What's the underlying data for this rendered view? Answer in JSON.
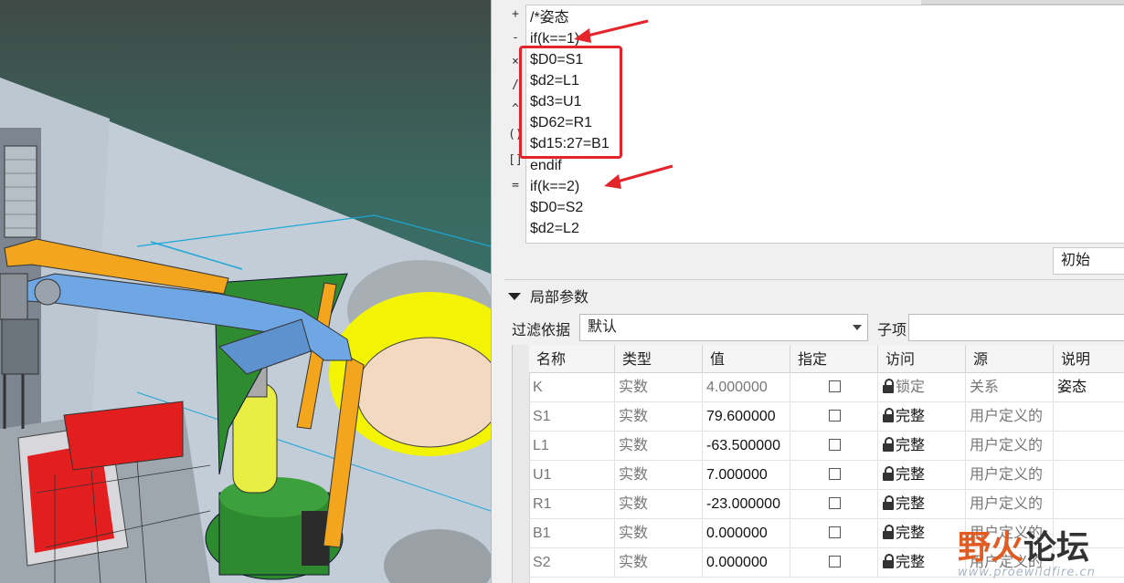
{
  "editor": {
    "gutter_symbols": [
      "+",
      "-",
      "×",
      "/",
      "^",
      "()",
      "[]",
      "="
    ],
    "lines": [
      "/*姿态",
      "if(k==1)",
      "$D0=S1",
      "$d2=L1",
      "$d3=U1",
      "$D62=R1",
      "$d15:27=B1",
      "endif",
      "if(k==2)",
      "$D0=S2",
      "$d2=L2"
    ],
    "initial_value": "初始"
  },
  "local_params": {
    "title": "局部参数",
    "filter_label": "过滤依据",
    "filter_value": "默认",
    "subitem_label": "子项",
    "columns": [
      "名称",
      "类型",
      "值",
      "指定",
      "访问",
      "源",
      "说明"
    ],
    "rows": [
      {
        "name": "K",
        "type": "实数",
        "value": "4.000000",
        "access": "锁定",
        "source": "关系",
        "desc": "姿态",
        "access_style": "light"
      },
      {
        "name": "S1",
        "type": "实数",
        "value": "79.600000",
        "access": "完整",
        "source": "用户定义的",
        "desc": "",
        "access_style": "dark"
      },
      {
        "name": "L1",
        "type": "实数",
        "value": "-63.500000",
        "access": "完整",
        "source": "用户定义的",
        "desc": "",
        "access_style": "dark"
      },
      {
        "name": "U1",
        "type": "实数",
        "value": "7.000000",
        "access": "完整",
        "source": "用户定义的",
        "desc": "",
        "access_style": "dark"
      },
      {
        "name": "R1",
        "type": "实数",
        "value": "-23.000000",
        "access": "完整",
        "source": "用户定义的",
        "desc": "",
        "access_style": "dark"
      },
      {
        "name": "B1",
        "type": "实数",
        "value": "0.000000",
        "access": "完整",
        "source": "用户定义的",
        "desc": "",
        "access_style": "dark"
      },
      {
        "name": "S2",
        "type": "实数",
        "value": "0.000000",
        "access": "完整",
        "source": "用户定义的",
        "desc": "",
        "access_style": "dark"
      }
    ]
  },
  "watermark": {
    "chars": [
      "野",
      "火",
      "论坛"
    ],
    "url": "www.proewildfire.cn"
  },
  "colors": {
    "highlight": "#e3242b",
    "robot_blue": "#6fa6e4",
    "robot_orange": "#f2a51d",
    "robot_green": "#2e8a2e",
    "robot_yellow": "#f0f020"
  }
}
